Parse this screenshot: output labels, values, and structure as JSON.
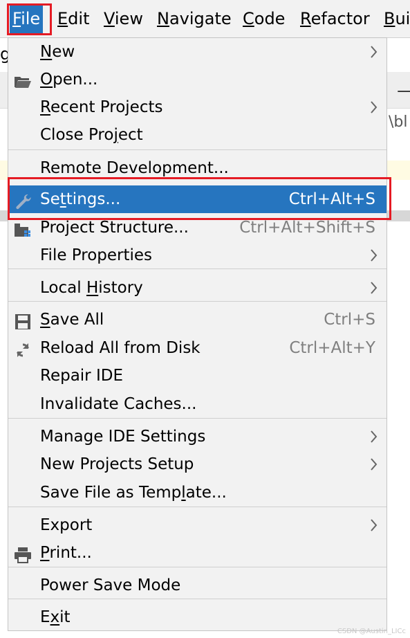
{
  "menubar": {
    "items": [
      {
        "label": "File",
        "mnemonic": "F",
        "rest": "ile"
      },
      {
        "label": "Edit",
        "mnemonic": "E",
        "rest": "dit"
      },
      {
        "label": "View",
        "mnemonic": "V",
        "rest": "iew"
      },
      {
        "label": "Navigate",
        "mnemonic": "N",
        "rest": "avigate"
      },
      {
        "label": "Code",
        "mnemonic": "C",
        "rest": "ode"
      },
      {
        "label": "Refactor",
        "mnemonic": "R",
        "rest": "efactor"
      },
      {
        "label": "Bui",
        "mnemonic": "B",
        "rest": "ui"
      }
    ]
  },
  "background": {
    "fragment_g": "g",
    "fragment_path": "\\bl"
  },
  "file_menu": {
    "items": [
      {
        "pre": "",
        "mn": "N",
        "post": "ew",
        "shortcut": "",
        "submenu": true,
        "icon": ""
      },
      {
        "pre": "",
        "mn": "O",
        "post": "pen...",
        "shortcut": "",
        "submenu": false,
        "icon": "folder-open-icon"
      },
      {
        "pre": "",
        "mn": "R",
        "post": "ecent Projects",
        "shortcut": "",
        "submenu": true,
        "icon": ""
      },
      {
        "pre": "Close Pro",
        "mn": "j",
        "post": "ect",
        "shortcut": "",
        "submenu": false,
        "icon": ""
      },
      {
        "pre": "Remote Development...",
        "mn": "",
        "post": "",
        "shortcut": "",
        "submenu": false,
        "icon": ""
      },
      {
        "pre": "Se",
        "mn": "t",
        "post": "tings...",
        "shortcut": "Ctrl+Alt+S",
        "submenu": false,
        "icon": "wrench-icon"
      },
      {
        "pre": "Project Structure...",
        "mn": "",
        "post": "",
        "shortcut": "Ctrl+Alt+Shift+S",
        "submenu": false,
        "icon": "project-structure-icon"
      },
      {
        "pre": "File Properties",
        "mn": "",
        "post": "",
        "shortcut": "",
        "submenu": true,
        "icon": ""
      },
      {
        "pre": "Local ",
        "mn": "H",
        "post": "istory",
        "shortcut": "",
        "submenu": true,
        "icon": ""
      },
      {
        "pre": "",
        "mn": "S",
        "post": "ave All",
        "shortcut": "Ctrl+S",
        "submenu": false,
        "icon": "save-icon"
      },
      {
        "pre": "Reload All from Disk",
        "mn": "",
        "post": "",
        "shortcut": "Ctrl+Alt+Y",
        "submenu": false,
        "icon": "reload-icon"
      },
      {
        "pre": "Repair IDE",
        "mn": "",
        "post": "",
        "shortcut": "",
        "submenu": false,
        "icon": ""
      },
      {
        "pre": "Invalidate Caches...",
        "mn": "",
        "post": "",
        "shortcut": "",
        "submenu": false,
        "icon": ""
      },
      {
        "pre": "Manage IDE Settings",
        "mn": "",
        "post": "",
        "shortcut": "",
        "submenu": true,
        "icon": ""
      },
      {
        "pre": "New Projects Setup",
        "mn": "",
        "post": "",
        "shortcut": "",
        "submenu": true,
        "icon": ""
      },
      {
        "pre": "Save File as Temp",
        "mn": "l",
        "post": "ate...",
        "shortcut": "",
        "submenu": false,
        "icon": ""
      },
      {
        "pre": "Export",
        "mn": "",
        "post": "",
        "shortcut": "",
        "submenu": true,
        "icon": ""
      },
      {
        "pre": "",
        "mn": "P",
        "post": "rint...",
        "shortcut": "",
        "submenu": false,
        "icon": "print-icon"
      },
      {
        "pre": "Power Save Mode",
        "mn": "",
        "post": "",
        "shortcut": "",
        "submenu": false,
        "icon": ""
      },
      {
        "pre": "E",
        "mn": "x",
        "post": "it",
        "shortcut": "",
        "submenu": false,
        "icon": ""
      }
    ],
    "selected_index": 5
  },
  "colors": {
    "selection": "#2675bf",
    "highlight_box": "#e51b24",
    "menu_bg": "#f2f2f2",
    "shortcut_text": "#7f7f7f"
  },
  "watermark": "CSDN @Austin_LICc"
}
